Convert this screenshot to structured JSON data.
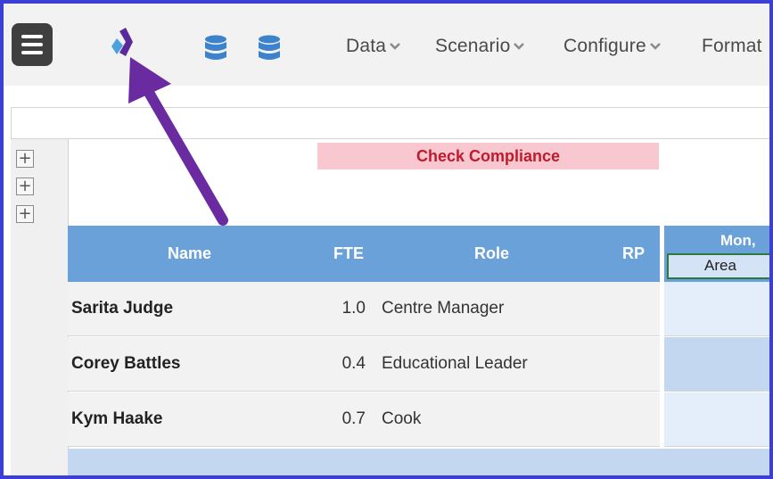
{
  "toolbar": {
    "menu_items": [
      {
        "label": "Data"
      },
      {
        "label": "Scenario"
      },
      {
        "label": "Configure"
      },
      {
        "label": "Format"
      }
    ]
  },
  "sheet": {
    "check_compliance_label": "Check Compliance",
    "headers": {
      "name": "Name",
      "fte": "FTE",
      "role": "Role",
      "rp": "RP"
    },
    "day_header": "Mon,",
    "day_subheader": "Area",
    "rows": [
      {
        "name": "Sarita Judge",
        "fte": "1.0",
        "role": "Centre Manager"
      },
      {
        "name": "Corey Battles",
        "fte": "0.4",
        "role": "Educational Leader"
      },
      {
        "name": "Kym Haake",
        "fte": "0.7",
        "role": "Cook"
      }
    ]
  },
  "colors": {
    "frame_border": "#3b3fd6",
    "header_blue": "#6aa1d8",
    "compliance_bg": "#f8c7cf",
    "compliance_text": "#c11a2c",
    "arrow": "#6a2aa0",
    "db_icon": "#3d83cc"
  },
  "icons": [
    "hamburger-menu-icon",
    "app-logo-icon",
    "database-icon",
    "database-icon",
    "chevron-down-icon",
    "plus-icon",
    "annotation-arrow"
  ]
}
